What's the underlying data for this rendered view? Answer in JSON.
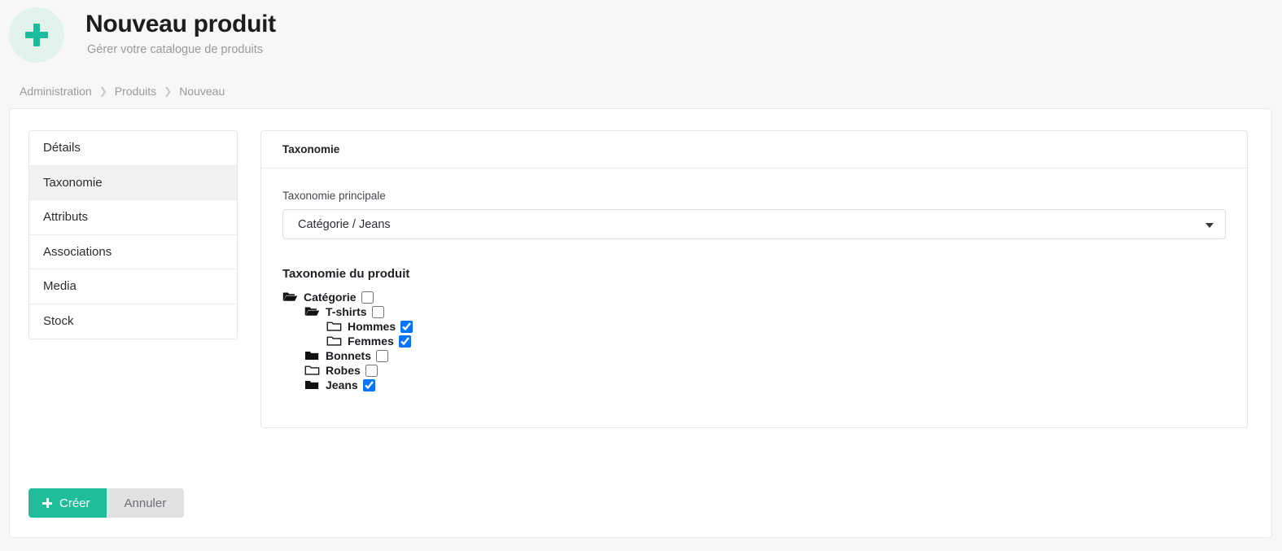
{
  "header": {
    "icon": "plus-icon",
    "title": "Nouveau produit",
    "subtitle": "Gérer votre catalogue de produits",
    "accent_color": "#1abc9c",
    "badge_bg": "#e2f3ec"
  },
  "breadcrumb": {
    "separator": "›",
    "items": [
      {
        "label": "Administration"
      },
      {
        "label": "Produits"
      },
      {
        "label": "Nouveau"
      }
    ]
  },
  "tabs": [
    {
      "id": "details",
      "label": "Détails",
      "active": false
    },
    {
      "id": "taxonomie",
      "label": "Taxonomie",
      "active": true
    },
    {
      "id": "attributs",
      "label": "Attributs",
      "active": false
    },
    {
      "id": "associations",
      "label": "Associations",
      "active": false
    },
    {
      "id": "media",
      "label": "Media",
      "active": false
    },
    {
      "id": "stock",
      "label": "Stock",
      "active": false
    }
  ],
  "panel": {
    "title": "Taxonomie",
    "primary_taxonomy": {
      "label": "Taxonomie principale",
      "value": "Catégorie / Jeans",
      "icon": "chevron-down-icon"
    },
    "tree_title": "Taxonomie du produit",
    "tree": [
      {
        "label": "Catégorie",
        "level": 1,
        "icon": "folder-open-icon",
        "checked": false
      },
      {
        "label": "T-shirts",
        "level": 2,
        "icon": "folder-open-icon",
        "checked": false
      },
      {
        "label": "Hommes",
        "level": 3,
        "icon": "folder-outline-icon",
        "checked": true
      },
      {
        "label": "Femmes",
        "level": 3,
        "icon": "folder-outline-icon",
        "checked": true
      },
      {
        "label": "Bonnets",
        "level": 2,
        "icon": "folder-filled-icon",
        "checked": false
      },
      {
        "label": "Robes",
        "level": 2,
        "icon": "folder-outline-icon",
        "checked": false
      },
      {
        "label": "Jeans",
        "level": 2,
        "icon": "folder-filled-icon",
        "checked": true
      }
    ]
  },
  "footer": {
    "create_label": "Créer",
    "create_icon": "plus-icon",
    "cancel_label": "Annuler",
    "create_color": "#20bd9b",
    "cancel_color": "#e2e2e3"
  }
}
